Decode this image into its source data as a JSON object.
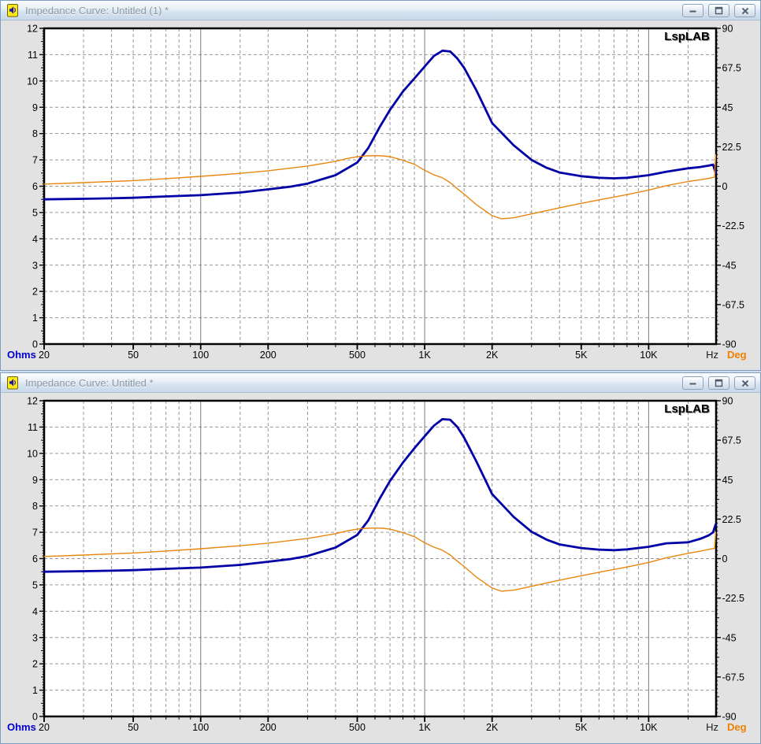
{
  "ui": {
    "colors": {
      "impedance_curve": "#0000a6",
      "phase_curve": "#e8860d",
      "ohms_label": "#0000cc",
      "deg_label": "#f08000",
      "hz_label": "#1a1a1a",
      "tick_text": "#000000",
      "grid_dashed": "#969696",
      "grid_solid": "#7a7a7a",
      "plot_border": "#000000",
      "plot_bg": "#ffffff",
      "client_bg": "#e2e2e2",
      "brand_text": "#000000",
      "brand_shadow": "#9a9a9a"
    },
    "windows": [
      {
        "title": "Impedance Curve: Untitled (1) *",
        "icon": "speaker-document-icon",
        "window_buttons": [
          "minimize",
          "restore",
          "close"
        ],
        "chart_data": {
          "type": "line",
          "x_scale": "log",
          "x_range": [
            20,
            20000
          ],
          "x_unit": "Hz",
          "x_tick_values": [
            20,
            50,
            100,
            200,
            500,
            1000,
            2000,
            5000,
            10000
          ],
          "x_tick_labels": [
            "20",
            "50",
            "100",
            "200",
            "500",
            "1K",
            "2K",
            "5K",
            "10K"
          ],
          "grid_mantissas": [
            1,
            1.5,
            2,
            3,
            4,
            5,
            6,
            7,
            8,
            9
          ],
          "grid": "on",
          "brand": "LspLAB",
          "left_axis": {
            "label": "Ohms",
            "range": [
              0,
              12
            ],
            "tick_labels": [
              "0",
              "1",
              "2",
              "3",
              "4",
              "5",
              "6",
              "7",
              "8",
              "9",
              "10",
              "11",
              "12"
            ]
          },
          "right_axis": {
            "label": "Deg",
            "range": [
              -90,
              90
            ],
            "tick_labels": [
              "-90",
              "-67.5",
              "-45",
              "-22.5",
              "0",
              "22.5",
              "45",
              "67.5",
              "90"
            ]
          },
          "series": [
            {
              "name": "impedance",
              "axis": "left",
              "color": "#0000a6",
              "width": 2.8,
              "points": [
                [
                  20,
                  5.5
                ],
                [
                  30,
                  5.52
                ],
                [
                  40,
                  5.54
                ],
                [
                  50,
                  5.56
                ],
                [
                  70,
                  5.61
                ],
                [
                  100,
                  5.66
                ],
                [
                  150,
                  5.76
                ],
                [
                  200,
                  5.88
                ],
                [
                  250,
                  5.98
                ],
                [
                  300,
                  6.1
                ],
                [
                  400,
                  6.42
                ],
                [
                  500,
                  6.9
                ],
                [
                  560,
                  7.45
                ],
                [
                  630,
                  8.25
                ],
                [
                  700,
                  8.9
                ],
                [
                  800,
                  9.6
                ],
                [
                  900,
                  10.1
                ],
                [
                  1000,
                  10.55
                ],
                [
                  1100,
                  10.95
                ],
                [
                  1200,
                  11.15
                ],
                [
                  1300,
                  11.12
                ],
                [
                  1400,
                  10.85
                ],
                [
                  1500,
                  10.5
                ],
                [
                  1700,
                  9.65
                ],
                [
                  2000,
                  8.4
                ],
                [
                  2500,
                  7.55
                ],
                [
                  3000,
                  7.0
                ],
                [
                  3500,
                  6.7
                ],
                [
                  4000,
                  6.52
                ],
                [
                  5000,
                  6.38
                ],
                [
                  6000,
                  6.32
                ],
                [
                  7000,
                  6.3
                ],
                [
                  8000,
                  6.32
                ],
                [
                  10000,
                  6.42
                ],
                [
                  12000,
                  6.55
                ],
                [
                  15000,
                  6.68
                ],
                [
                  17000,
                  6.73
                ],
                [
                  18500,
                  6.78
                ],
                [
                  19400,
                  6.82
                ],
                [
                  19900,
                  6.5
                ]
              ]
            },
            {
              "name": "phase",
              "axis": "right",
              "color": "#e8860d",
              "width": 1.4,
              "points": [
                [
                  20,
                  1.2
                ],
                [
                  30,
                  2.0
                ],
                [
                  50,
                  3.2
                ],
                [
                  70,
                  4.3
                ],
                [
                  100,
                  5.6
                ],
                [
                  150,
                  7.3
                ],
                [
                  200,
                  8.8
                ],
                [
                  300,
                  11.5
                ],
                [
                  400,
                  14.2
                ],
                [
                  450,
                  15.8
                ],
                [
                  500,
                  16.8
                ],
                [
                  550,
                  17.3
                ],
                [
                  600,
                  17.4
                ],
                [
                  650,
                  17.3
                ],
                [
                  700,
                  16.8
                ],
                [
                  800,
                  14.8
                ],
                [
                  900,
                  12.5
                ],
                [
                  1000,
                  9.0
                ],
                [
                  1100,
                  6.5
                ],
                [
                  1200,
                  4.8
                ],
                [
                  1300,
                  2.0
                ],
                [
                  1400,
                  -1.5
                ],
                [
                  1500,
                  -4.5
                ],
                [
                  1700,
                  -10.5
                ],
                [
                  2000,
                  -16.8
                ],
                [
                  2200,
                  -18.6
                ],
                [
                  2500,
                  -18.0
                ],
                [
                  3000,
                  -15.8
                ],
                [
                  4000,
                  -12.3
                ],
                [
                  5000,
                  -9.8
                ],
                [
                  6000,
                  -7.8
                ],
                [
                  7000,
                  -6.2
                ],
                [
                  8000,
                  -4.8
                ],
                [
                  10000,
                  -2.2
                ],
                [
                  12000,
                  0.3
                ],
                [
                  15000,
                  2.7
                ],
                [
                  17000,
                  3.7
                ],
                [
                  19000,
                  4.7
                ],
                [
                  19700,
                  5.3
                ],
                [
                  19900,
                  18.0
                ]
              ]
            }
          ]
        }
      },
      {
        "title": "Impedance Curve: Untitled *",
        "icon": "speaker-document-icon",
        "window_buttons": [
          "minimize",
          "restore",
          "close"
        ],
        "chart_data": {
          "type": "line",
          "x_scale": "log",
          "x_range": [
            20,
            20000
          ],
          "x_unit": "Hz",
          "x_tick_values": [
            20,
            50,
            100,
            200,
            500,
            1000,
            2000,
            5000,
            10000
          ],
          "x_tick_labels": [
            "20",
            "50",
            "100",
            "200",
            "500",
            "1K",
            "2K",
            "5K",
            "10K"
          ],
          "grid_mantissas": [
            1,
            1.5,
            2,
            3,
            4,
            5,
            6,
            7,
            8,
            9
          ],
          "grid": "on",
          "brand": "LspLAB",
          "left_axis": {
            "label": "Ohms",
            "range": [
              0,
              12
            ],
            "tick_labels": [
              "0",
              "1",
              "2",
              "3",
              "4",
              "5",
              "6",
              "7",
              "8",
              "9",
              "10",
              "11",
              "12"
            ]
          },
          "right_axis": {
            "label": "Deg",
            "range": [
              -90,
              90
            ],
            "tick_labels": [
              "-90",
              "-67.5",
              "-45",
              "-22.5",
              "0",
              "22.5",
              "45",
              "67.5",
              "90"
            ]
          },
          "series": [
            {
              "name": "impedance",
              "axis": "left",
              "color": "#0000a6",
              "width": 2.8,
              "points": [
                [
                  20,
                  5.5
                ],
                [
                  30,
                  5.52
                ],
                [
                  40,
                  5.54
                ],
                [
                  50,
                  5.56
                ],
                [
                  70,
                  5.61
                ],
                [
                  100,
                  5.66
                ],
                [
                  150,
                  5.76
                ],
                [
                  200,
                  5.88
                ],
                [
                  250,
                  5.98
                ],
                [
                  300,
                  6.1
                ],
                [
                  400,
                  6.42
                ],
                [
                  500,
                  6.9
                ],
                [
                  560,
                  7.45
                ],
                [
                  630,
                  8.28
                ],
                [
                  700,
                  8.95
                ],
                [
                  800,
                  9.65
                ],
                [
                  900,
                  10.2
                ],
                [
                  1000,
                  10.65
                ],
                [
                  1100,
                  11.05
                ],
                [
                  1200,
                  11.3
                ],
                [
                  1300,
                  11.28
                ],
                [
                  1400,
                  11.0
                ],
                [
                  1500,
                  10.6
                ],
                [
                  1700,
                  9.7
                ],
                [
                  2000,
                  8.45
                ],
                [
                  2500,
                  7.58
                ],
                [
                  3000,
                  7.02
                ],
                [
                  3500,
                  6.72
                ],
                [
                  4000,
                  6.54
                ],
                [
                  5000,
                  6.4
                ],
                [
                  6000,
                  6.34
                ],
                [
                  7000,
                  6.32
                ],
                [
                  8000,
                  6.35
                ],
                [
                  10000,
                  6.45
                ],
                [
                  12000,
                  6.58
                ],
                [
                  15000,
                  6.62
                ],
                [
                  17000,
                  6.75
                ],
                [
                  18500,
                  6.88
                ],
                [
                  19400,
                  7.0
                ],
                [
                  19900,
                  7.3
                ]
              ]
            },
            {
              "name": "phase",
              "axis": "right",
              "color": "#e8860d",
              "width": 1.4,
              "points": [
                [
                  20,
                  1.2
                ],
                [
                  30,
                  2.0
                ],
                [
                  50,
                  3.2
                ],
                [
                  70,
                  4.3
                ],
                [
                  100,
                  5.6
                ],
                [
                  150,
                  7.3
                ],
                [
                  200,
                  8.8
                ],
                [
                  300,
                  11.5
                ],
                [
                  400,
                  14.2
                ],
                [
                  450,
                  15.8
                ],
                [
                  500,
                  16.8
                ],
                [
                  550,
                  17.3
                ],
                [
                  600,
                  17.4
                ],
                [
                  650,
                  17.3
                ],
                [
                  700,
                  16.8
                ],
                [
                  800,
                  14.8
                ],
                [
                  900,
                  12.5
                ],
                [
                  1000,
                  9.0
                ],
                [
                  1100,
                  6.5
                ],
                [
                  1200,
                  4.8
                ],
                [
                  1300,
                  2.0
                ],
                [
                  1400,
                  -1.5
                ],
                [
                  1500,
                  -4.5
                ],
                [
                  1700,
                  -10.5
                ],
                [
                  2000,
                  -16.8
                ],
                [
                  2200,
                  -18.6
                ],
                [
                  2500,
                  -18.0
                ],
                [
                  3000,
                  -15.8
                ],
                [
                  4000,
                  -12.3
                ],
                [
                  5000,
                  -9.8
                ],
                [
                  6000,
                  -7.8
                ],
                [
                  7000,
                  -6.2
                ],
                [
                  8000,
                  -4.8
                ],
                [
                  10000,
                  -2.2
                ],
                [
                  12000,
                  0.5
                ],
                [
                  15000,
                  3.0
                ],
                [
                  17000,
                  4.2
                ],
                [
                  19000,
                  5.5
                ],
                [
                  19700,
                  5.8
                ],
                [
                  19900,
                  15.0
                ]
              ]
            }
          ]
        }
      }
    ]
  }
}
